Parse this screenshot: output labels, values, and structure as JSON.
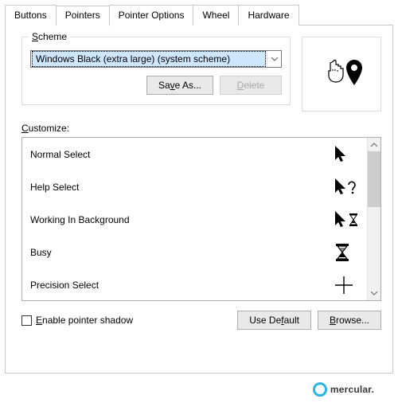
{
  "tabs": [
    "Buttons",
    "Pointers",
    "Pointer Options",
    "Wheel",
    "Hardware"
  ],
  "activeTab": 1,
  "scheme": {
    "legend_html": "<span class='underline'>S</span>cheme",
    "selected": "Windows Black (extra large) (system scheme)",
    "saveAs_html": "Sa<span class='underline'>v</span>e As...",
    "delete_html": "<span class='underline'>D</span>elete"
  },
  "customize": {
    "label_html": "<span class='underline'>C</span>ustomize:",
    "items": [
      {
        "label": "Normal Select",
        "icon": "cursor"
      },
      {
        "label": "Help Select",
        "icon": "cursor-help"
      },
      {
        "label": "Working In Background",
        "icon": "cursor-hourglass"
      },
      {
        "label": "Busy",
        "icon": "hourglass"
      },
      {
        "label": "Precision Select",
        "icon": "crosshair"
      }
    ]
  },
  "enableShadow_html": "<span class='underline'>E</span>nable pointer shadow",
  "enableShadowChecked": false,
  "useDefault_html": "Use De<span class='underline'>f</span>ault",
  "browse_html": "<span class='underline'>B</span>rowse...",
  "watermark": "mercular."
}
